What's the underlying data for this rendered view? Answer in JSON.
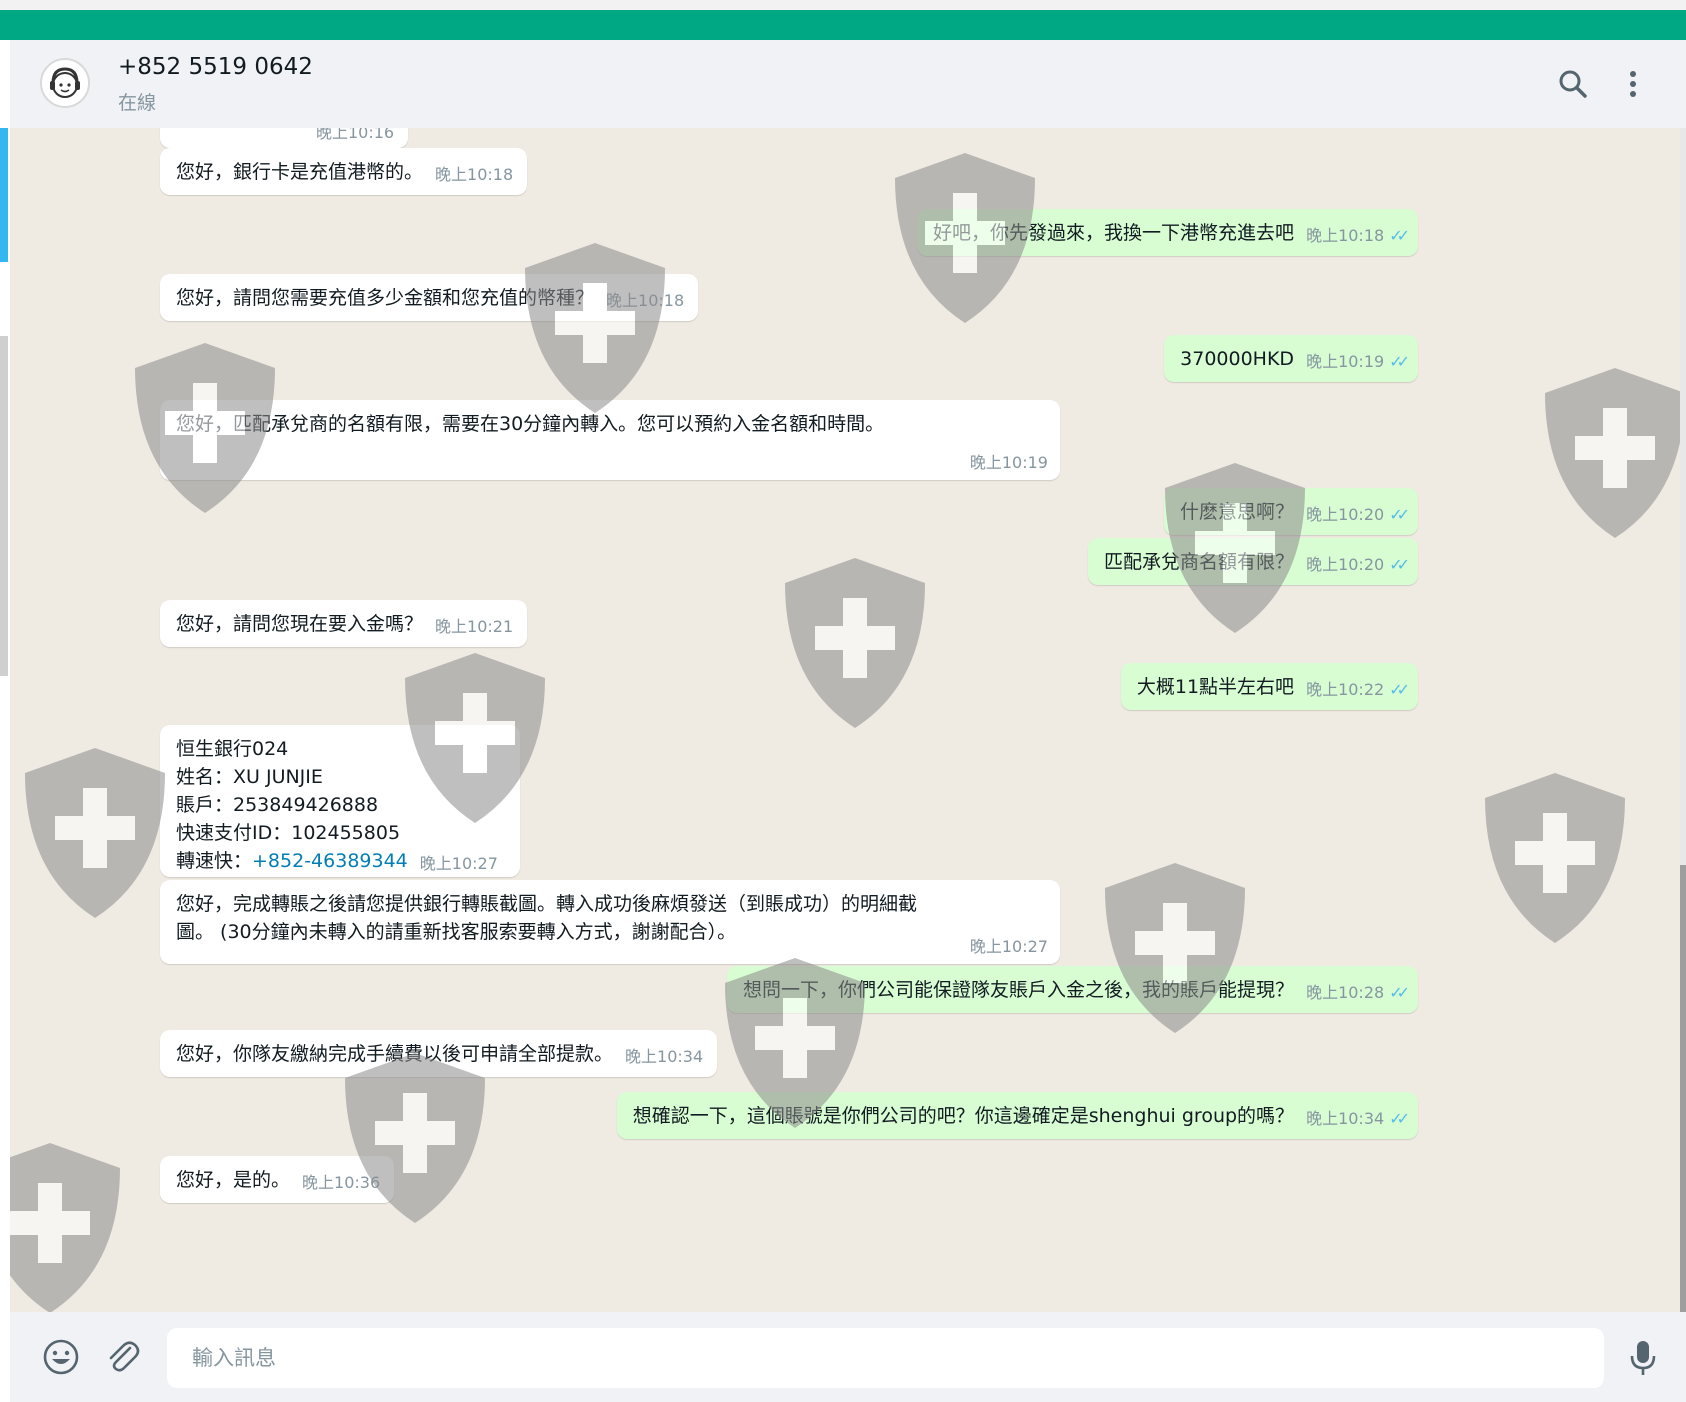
{
  "header": {
    "contact_name": "+852 5519 0642",
    "status": "在線"
  },
  "messages": [
    {
      "dir": "in",
      "text": "晚上10:16",
      "time": ""
    },
    {
      "dir": "in",
      "text": "您好，銀行卡是充值港幣的。",
      "time": "晚上10:18"
    },
    {
      "dir": "out",
      "text": "好吧，你先發過來，我換一下港幣充進去吧",
      "time": "晚上10:18"
    },
    {
      "dir": "in",
      "text": "您好，請問您需要充值多少金額和您充值的幣種？",
      "time": "晚上10:18"
    },
    {
      "dir": "out",
      "text": "370000HKD",
      "time": "晚上10:19"
    },
    {
      "dir": "in",
      "text": "您好，匹配承兌商的名額有限，需要在30分鐘內轉入。您可以預約入金名額和時間。",
      "time": "晚上10:19"
    },
    {
      "dir": "out",
      "text": "什麽意思啊？",
      "time": "晚上10:20"
    },
    {
      "dir": "out",
      "text": "匹配承兌商名額有限？",
      "time": "晚上10:20"
    },
    {
      "dir": "in",
      "text": "您好，請問您現在要入金嗎？",
      "time": "晚上10:21"
    },
    {
      "dir": "out",
      "text": "大概11點半左右吧",
      "time": "晚上10:22"
    },
    {
      "dir": "in",
      "lines": [
        "恒生銀行024",
        "姓名：XU JUNJIE",
        "賬戶：253849426888",
        "快速支付ID：102455805"
      ],
      "last_label": "轉速快：",
      "link": "+852-46389344",
      "time": "晚上10:27"
    },
    {
      "dir": "in",
      "lines": [
        "您好，完成轉賬之後請您提供銀行轉賬截圖。轉入成功後麻煩發送（到賬成功）的明細截",
        "圖。 (30分鐘內未轉入的請重新找客服索要轉入方式，謝謝配合）。"
      ],
      "time": "晚上10:27"
    },
    {
      "dir": "out",
      "text": "想問一下，你們公司能保證隊友賬戶入金之後，我的賬戶能提現？",
      "time": "晚上10:28"
    },
    {
      "dir": "in",
      "text": "您好，你隊友繳納完成手續費以後可申請全部提款。",
      "time": "晚上10:34"
    },
    {
      "dir": "out",
      "text": "想確認一下，這個賬號是你們公司的吧？你這邊確定是shenghui group的嗎？",
      "time": "晚上10:34"
    },
    {
      "dir": "in",
      "text": "您好，是的。",
      "time": "晚上10:36"
    }
  ],
  "composer": {
    "placeholder": "輸入訊息"
  },
  "icons": [
    "avatar-icon",
    "search-icon",
    "menu-icon",
    "emoji-icon",
    "attach-icon",
    "mic-icon",
    "double-check-icon"
  ],
  "colors": {
    "accent": "#00a884",
    "incoming_bubble": "#ffffff",
    "outgoing_bubble": "#d9fdd3",
    "chat_background": "#efeae2",
    "read_ticks": "#53bdeb",
    "link": "#027eb5"
  }
}
